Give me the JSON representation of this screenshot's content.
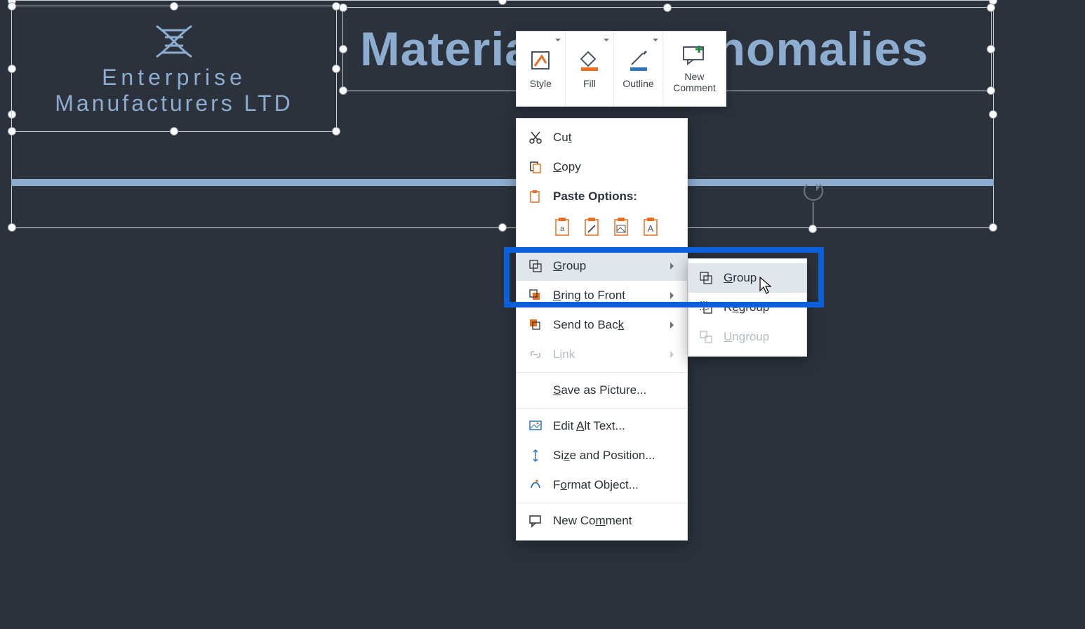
{
  "logo": {
    "line1": "Enterprise",
    "line2": "Manufacturers LTD"
  },
  "slide_title": "Material Cost Anomalies",
  "mini_toolbar": {
    "style": "Style",
    "fill": "Fill",
    "outline": "Outline",
    "new_comment_line1": "New",
    "new_comment_line2": "Comment"
  },
  "context_menu": {
    "cut": "Cut",
    "copy": "Copy",
    "paste_options": "Paste Options:",
    "group": "Group",
    "bring_to_front": "Bring to Front",
    "send_to_back": "Send to Back",
    "link": "Link",
    "save_as_picture": "Save as Picture...",
    "edit_alt_text": "Edit Alt Text...",
    "size_and_position": "Size and Position...",
    "format_object": "Format Object...",
    "new_comment": "New Comment"
  },
  "submenu": {
    "group": "Group",
    "regroup": "Regroup",
    "ungroup": "Ungroup"
  }
}
